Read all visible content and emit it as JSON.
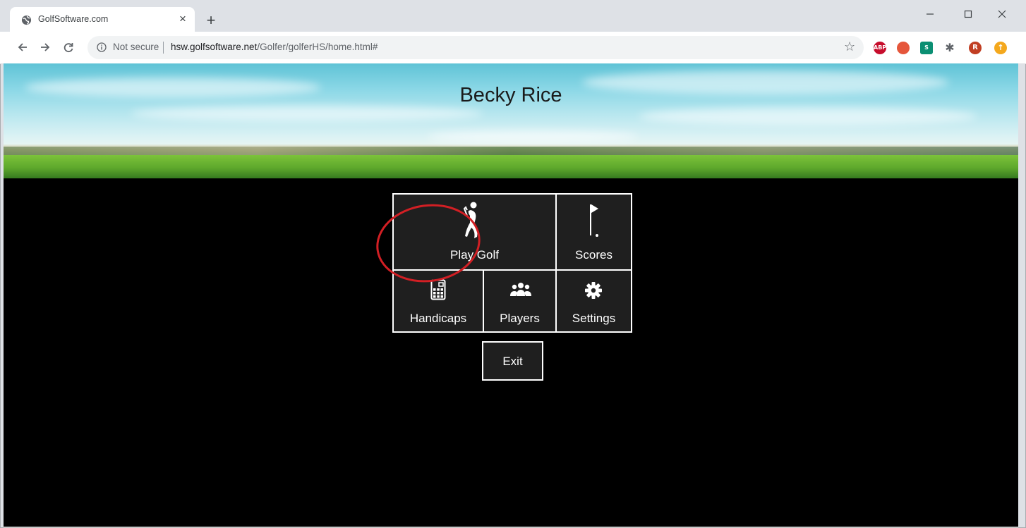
{
  "browser": {
    "tab_title": "GolfSoftware.com",
    "new_tab_label": "+",
    "close_tab_label": "×",
    "security_label": "Not secure",
    "url_host": "hsw.golfsoftware.net",
    "url_path": "/Golfer/golferHS/home.html#",
    "extensions": [
      {
        "name": "ABP",
        "color": "#c70d2c"
      },
      {
        "name": "",
        "color": "#e5563b"
      },
      {
        "name": "S",
        "color": "#0b8f73"
      },
      {
        "name": "",
        "color": "#5f6368"
      },
      {
        "name": "R",
        "color": "#c13e22"
      },
      {
        "name": "",
        "color": "#f4a81d"
      }
    ]
  },
  "header": {
    "player_name": "Becky Rice"
  },
  "menu": {
    "play_golf": {
      "label": "Play Golf",
      "icon": "golfer-icon"
    },
    "scores": {
      "label": "Scores",
      "icon": "flag-icon"
    },
    "handicaps": {
      "label": "Handicaps",
      "icon": "calculator-icon"
    },
    "players": {
      "label": "Players",
      "icon": "group-icon"
    },
    "settings": {
      "label": "Settings",
      "icon": "gear-icon"
    },
    "exit": {
      "label": "Exit"
    }
  },
  "annotation": {
    "highlight_color": "#d21f24"
  }
}
